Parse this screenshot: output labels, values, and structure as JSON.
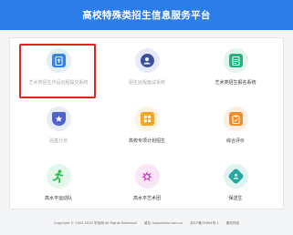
{
  "header": {
    "title": "高校特殊类招生信息服务平台"
  },
  "tiles": [
    {
      "label": "艺术类招生作品远程提交系统",
      "muted": true,
      "circle": "#e3eefc",
      "inner": "#2f84ee",
      "icon": "upload-document-icon"
    },
    {
      "label": "招生远程面试系统",
      "muted": true,
      "circle": "#e8eaf9",
      "inner": "#3b4f9c",
      "icon": "video-interview-icon"
    },
    {
      "label": "艺术类招生报名系统",
      "muted": false,
      "circle": "#e3f4ee",
      "inner": "#27b07a",
      "icon": "registration-form-icon"
    },
    {
      "label": "强基计划",
      "muted": true,
      "circle": "#e8ebf9",
      "inner": "#4d63d3",
      "icon": "shield-star-icon"
    },
    {
      "label": "高校专项计划招生",
      "muted": false,
      "circle": "#fdf2e2",
      "inner": "#f2a51d",
      "icon": "grid-plan-icon"
    },
    {
      "label": "综合评价",
      "muted": false,
      "circle": "#fdeee2",
      "inner": "#f08b2a",
      "icon": "evaluation-clipboard-icon"
    },
    {
      "label": "高水平运动队",
      "muted": false,
      "circle": "#e5f6ea",
      "inner": "#2fbf55",
      "icon": "running-athlete-icon"
    },
    {
      "label": "高水平艺术团",
      "muted": false,
      "circle": "#f9e7f5",
      "inner": "#d44bb7",
      "icon": "art-troupe-icon"
    },
    {
      "label": "保送生",
      "muted": false,
      "circle": "#e0f3f2",
      "inner": "#26a8a2",
      "icon": "recommended-student-icon"
    }
  ],
  "footer": {
    "copyright": "Copyright © 2003-2020 学信网 All Rights Reserved",
    "domain": "域名: kaoshichsi.com.cn",
    "icp": "京ICP备19004号-1",
    "service": "服务热线"
  }
}
